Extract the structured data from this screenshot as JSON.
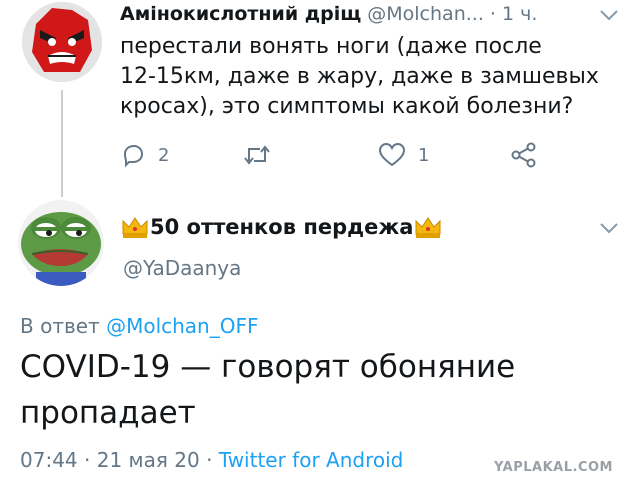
{
  "parent_tweet": {
    "display_name": "Амінокислотний дріщ",
    "handle": "@Molchan...",
    "separator": "·",
    "timestamp": "1 ч.",
    "text_lines": [
      "перестали вонять ноги (даже после",
      "12-15км, даже в жару, даже в замшевых",
      "кросах), это симптомы какой болезни?"
    ],
    "actions": {
      "reply_count": "2",
      "retweet_count": "",
      "like_count": "1"
    }
  },
  "main_tweet": {
    "display_name": "50 оттенков пердежа",
    "handle": "@YaDaanya",
    "reply_prefix": "В ответ",
    "reply_to": "@Molchan_OFF",
    "text_lines": [
      "COVID-19 — говорят обоняние",
      "пропадает"
    ],
    "time": "07:44",
    "date_sep": "·",
    "date": "21 мая 20",
    "source_sep": "·",
    "source": "Twitter for Android"
  },
  "watermark": "YAPLAKAL.COM",
  "colors": {
    "link": "#1da1f2",
    "secondary_text": "#657786",
    "primary_text": "#14171a",
    "thread_line": "#c8ced3"
  },
  "icons": {
    "parent_avatar": "red-angry-face-avatar",
    "main_avatar": "pepe-frog-avatar",
    "name_decoration": "crown-icon"
  }
}
